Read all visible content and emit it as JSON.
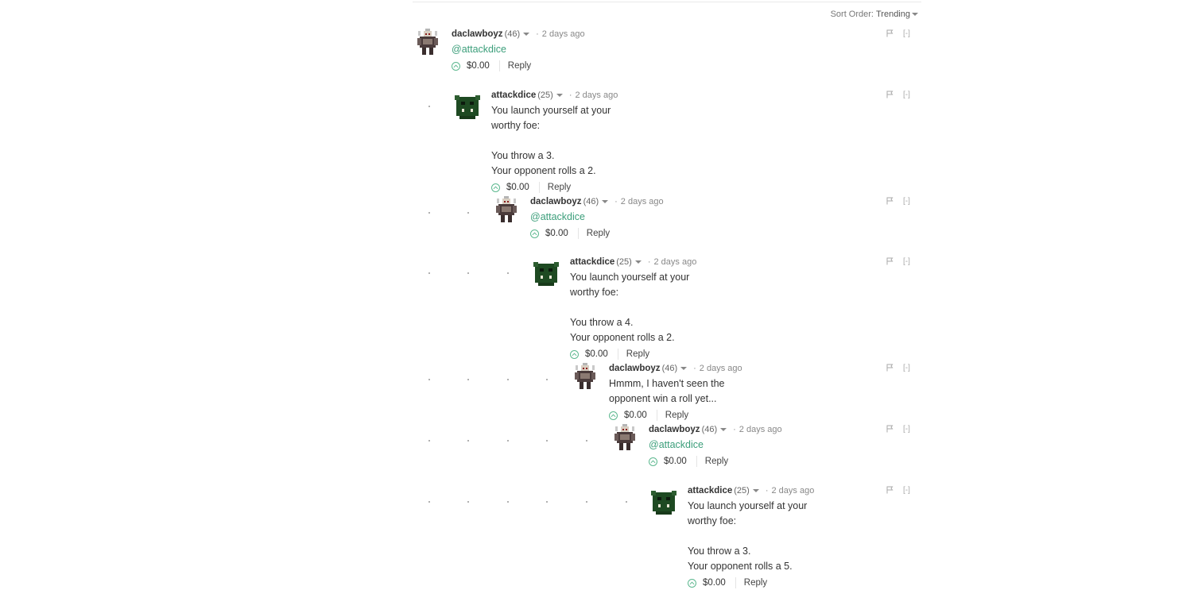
{
  "sort": {
    "label": "Sort Order:",
    "value": "Trending"
  },
  "controls": {
    "collapse_label": "[-]"
  },
  "comments": [
    {
      "author": "daclawboyz",
      "rep": "(46)",
      "time": "2 days ago",
      "text": "@attackdice",
      "is_mention": true,
      "payout": "$0.00",
      "reply": "Reply",
      "avatar": "robot-avatar-icon"
    },
    {
      "author": "attackdice",
      "rep": "(25)",
      "time": "2 days ago",
      "text": "You launch yourself at your worthy foe:\n\nYou throw a 3.\nYour opponent rolls a 2.",
      "is_mention": false,
      "payout": "$0.00",
      "reply": "Reply",
      "avatar": "orc-avatar-icon"
    },
    {
      "author": "daclawboyz",
      "rep": "(46)",
      "time": "2 days ago",
      "text": "@attackdice",
      "is_mention": true,
      "payout": "$0.00",
      "reply": "Reply",
      "avatar": "robot-avatar-icon"
    },
    {
      "author": "attackdice",
      "rep": "(25)",
      "time": "2 days ago",
      "text": "You launch yourself at your worthy foe:\n\nYou throw a 4.\nYour opponent rolls a 2.",
      "is_mention": false,
      "payout": "$0.00",
      "reply": "Reply",
      "avatar": "orc-avatar-icon"
    },
    {
      "author": "daclawboyz",
      "rep": "(46)",
      "time": "2 days ago",
      "text": "Hmmm, I haven't seen the opponent win a roll yet...",
      "is_mention": false,
      "payout": "$0.00",
      "reply": "Reply",
      "avatar": "robot-avatar-icon"
    },
    {
      "author": "daclawboyz",
      "rep": "(46)",
      "time": "2 days ago",
      "text": "@attackdice",
      "is_mention": true,
      "payout": "$0.00",
      "reply": "Reply",
      "avatar": "robot-avatar-icon"
    },
    {
      "author": "attackdice",
      "rep": "(25)",
      "time": "2 days ago",
      "text": "You launch yourself at your worthy foe:\n\nYou throw a 3.\nYour opponent rolls a 5.",
      "is_mention": false,
      "payout": "$0.00",
      "reply": "Reply",
      "avatar": "orc-avatar-icon"
    }
  ],
  "colors": {
    "accent": "#3b9e7a",
    "text": "#333333",
    "muted": "#888888"
  }
}
